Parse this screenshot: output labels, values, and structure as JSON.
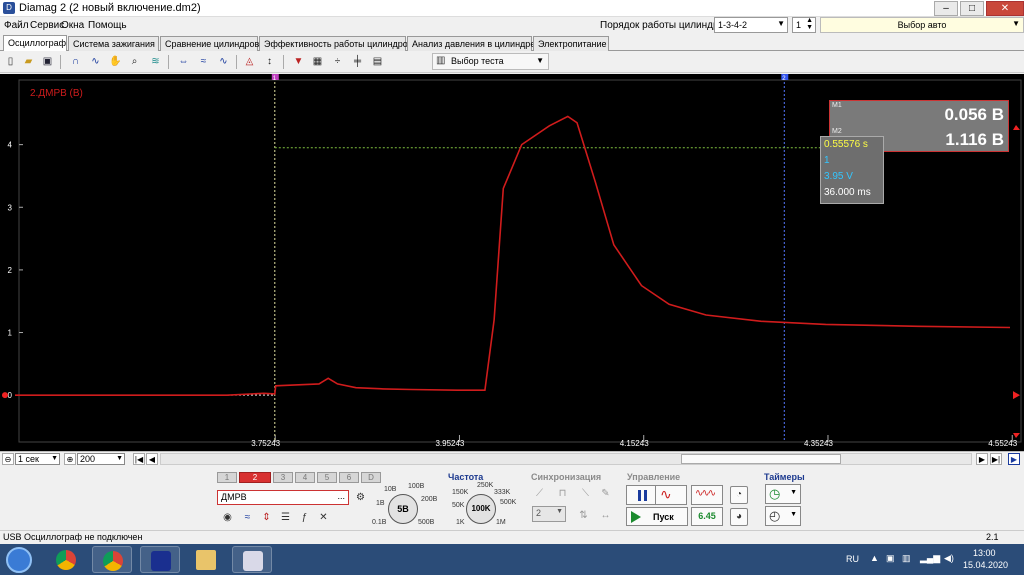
{
  "window": {
    "title": "Diamag 2 (2 новый включение.dm2)"
  },
  "menu": {
    "items": [
      "Файл",
      "Сервис",
      "Окна",
      "Помощь"
    ],
    "cylinder_order_label": "Порядок работы цилиндров",
    "cylinder_order_value": "1-3-4-2",
    "cylinder_number": "1",
    "auto_select": "Выбор авто"
  },
  "tabs": [
    {
      "label": "Осциллограф",
      "active": true
    },
    {
      "label": "Система зажигания",
      "active": false
    },
    {
      "label": "Сравнение цилиндров",
      "active": false
    },
    {
      "label": "Эффективность работы цилиндров",
      "active": false
    },
    {
      "label": "Анализ давления в цилиндре",
      "active": false
    },
    {
      "label": "Электропитание",
      "active": false
    }
  ],
  "toolbar": {
    "test_select": "Выбор теста"
  },
  "scope": {
    "channel_label": "2.ДМРВ (В)",
    "cursor_marker_1": "1",
    "cursor_marker_2": "2",
    "readout": {
      "m1_tag": "M1",
      "m1_value": "0.056 В",
      "m2_tag": "M2",
      "m2_value": "1.116 В"
    },
    "cursor_info": {
      "time": "0.55576 s",
      "index": "1",
      "voltage": "3.95 V",
      "delta": "36.000 ms"
    },
    "colors": {
      "signal": "#d01c1c",
      "cursor": "#e0e0a0",
      "cursor2": "#5577ff"
    }
  },
  "chart_data": {
    "type": "line",
    "title": "2.ДМРВ (В)",
    "xlabel": "",
    "ylabel": "",
    "x_ticks": [
      "3.75243",
      "3.95243",
      "4.15243",
      "4.35243",
      "4.55243"
    ],
    "y_ticks": [
      "0",
      "1",
      "2",
      "3",
      "4"
    ],
    "xlim": [
      3.47,
      4.55
    ],
    "ylim": [
      -0.62,
      5.0
    ],
    "series": [
      {
        "x": [
          3.47,
          3.7,
          3.74,
          3.752,
          3.753,
          3.8,
          3.81,
          3.82,
          3.84,
          3.87,
          3.9,
          3.95,
          3.98,
          3.99,
          4.0,
          4.02,
          4.05,
          4.07,
          4.08,
          4.1,
          4.12,
          4.15,
          4.18,
          4.22,
          4.28,
          4.35,
          4.45,
          4.55
        ],
        "y": [
          0.0,
          0.0,
          0.03,
          0.02,
          0.15,
          0.18,
          0.27,
          0.18,
          0.12,
          0.1,
          0.09,
          0.08,
          0.08,
          1.2,
          3.3,
          4.0,
          4.3,
          4.45,
          4.35,
          3.4,
          2.4,
          1.75,
          1.45,
          1.28,
          1.18,
          1.13,
          1.1,
          1.08
        ]
      }
    ],
    "cursors": [
      {
        "name": "1",
        "x": 3.752,
        "y": 3.95
      },
      {
        "name": "2",
        "x": 4.305
      }
    ]
  },
  "hscroll": {
    "time_div": "1 сек",
    "count": "200"
  },
  "panel": {
    "channels": [
      "1",
      "2",
      "3",
      "4",
      "5",
      "6",
      "D"
    ],
    "active_channel": "2",
    "channel_name": "ДМРВ",
    "channel_dots": "...",
    "voltage": {
      "labels": [
        "10В",
        "100В",
        "1В",
        "200В",
        "0.1В",
        "500В"
      ],
      "value": "5В"
    },
    "freq_title": "Частота",
    "freq": {
      "labels": [
        "250K",
        "150K",
        "333K",
        "50K",
        "500K",
        "1K",
        "1M"
      ],
      "value": "100K"
    },
    "sync_title": "Синхронизация",
    "sync_value": "2",
    "control_title": "Управление",
    "run_label": "Пуск",
    "rate_label": "6.45",
    "timers_title": "Таймеры"
  },
  "status": {
    "text": "USB Осциллограф не подключен",
    "version": "2.1"
  },
  "taskbar": {
    "lang": "RU",
    "time": "13:00",
    "date": "15.04.2020"
  }
}
